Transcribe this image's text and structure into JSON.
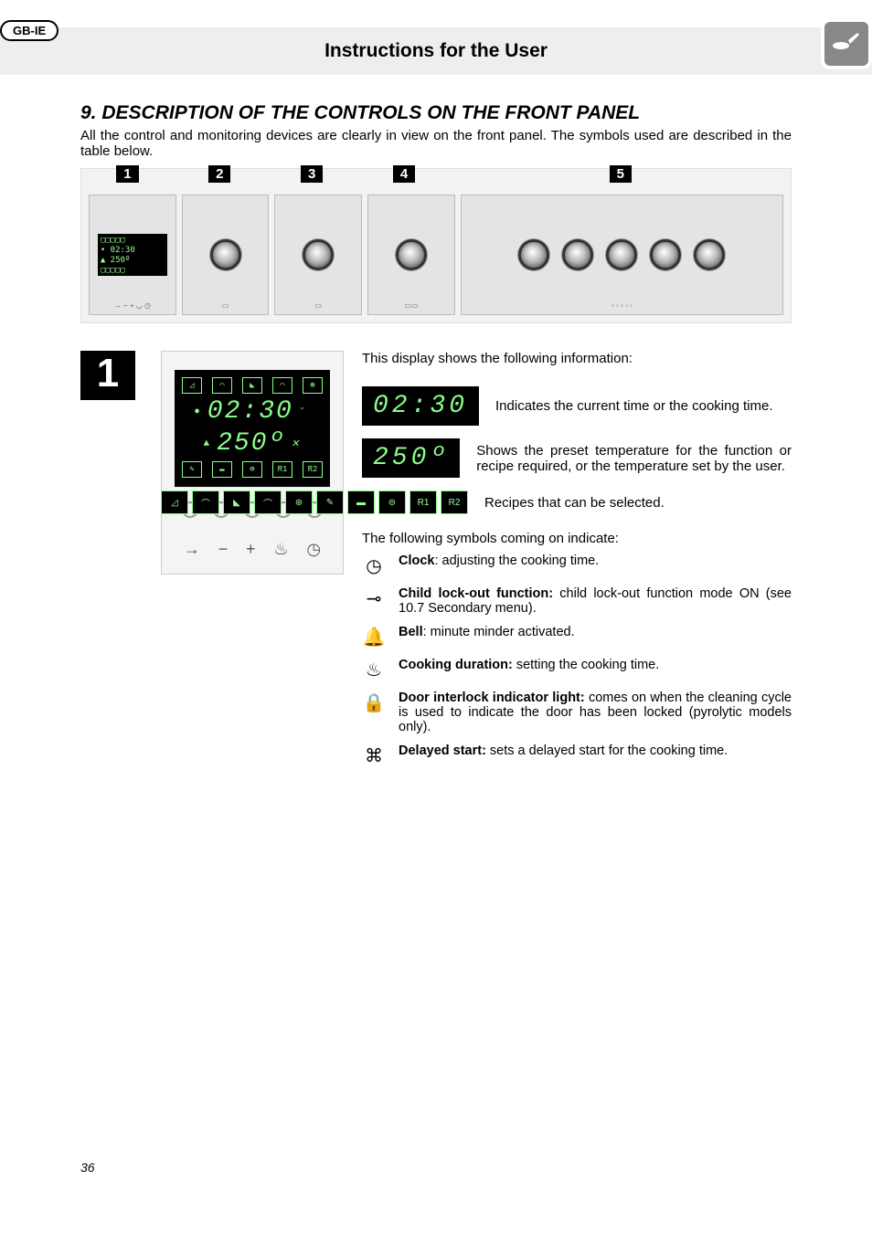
{
  "header": {
    "locale": "GB-IE",
    "title": "Instructions for the User"
  },
  "section": {
    "number": "9.",
    "title": "DESCRIPTION OF THE CONTROLS ON THE FRONT PANEL",
    "intro": "All the control and monitoring devices are clearly in view on the front panel. The symbols used are described in the table below."
  },
  "panelLabels": [
    "1",
    "2",
    "3",
    "4",
    "5"
  ],
  "displayBlock": {
    "bigNum": "1",
    "lead": "This display shows the following information:",
    "lcd": {
      "time": "02:30",
      "temp": "250º",
      "recipeLabels": [
        "R1",
        "R2"
      ]
    },
    "rows": [
      {
        "visual": "02:30",
        "text": "Indicates the current time or the cooking time."
      },
      {
        "visual": "250º",
        "text": "Shows the preset temperature for the function or recipe required, or the temperature set by the user."
      },
      {
        "visual": "recipes",
        "text": "Recipes that can be selected."
      }
    ],
    "symbolsHead": "The following symbols coming on indicate:",
    "symbols": [
      {
        "icon": "clock",
        "bold": "Clock",
        "rest": ": adjusting the cooking time."
      },
      {
        "icon": "key",
        "bold": "Child lock-out function:",
        "rest": " child lock-out function mode ON (see 10.7 Secondary menu)."
      },
      {
        "icon": "bell",
        "bold": "Bell",
        "rest": ": minute minder activated."
      },
      {
        "icon": "pot-steam",
        "bold": "Cooking duration:",
        "rest": " setting the cooking time."
      },
      {
        "icon": "lock",
        "bold": "Door interlock indicator light:",
        "rest": " comes on when the cleaning cycle is used to indicate the door has been locked (pyrolytic models only)."
      },
      {
        "icon": "pot-cross",
        "bold": "Delayed start:",
        "rest": " sets a delayed start for the cooking time."
      }
    ]
  },
  "pageNumber": "36"
}
